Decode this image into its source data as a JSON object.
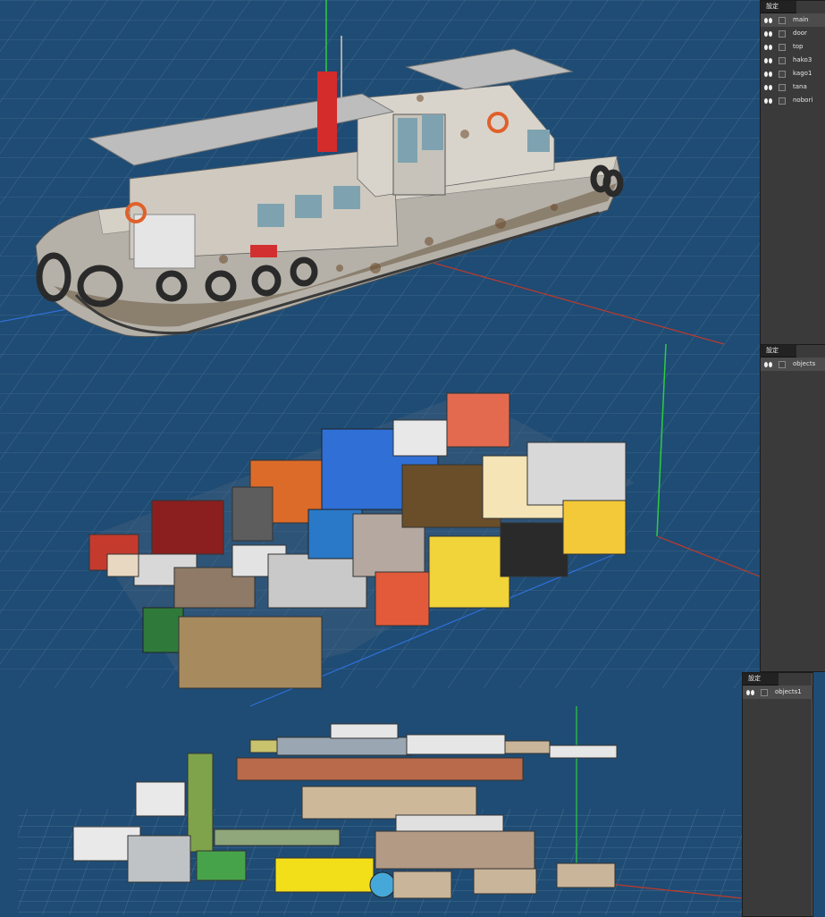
{
  "panels": [
    {
      "title": "設定",
      "layers": [
        {
          "name": "main",
          "selected": true
        },
        {
          "name": "door",
          "selected": false
        },
        {
          "name": "top",
          "selected": false
        },
        {
          "name": "hako3",
          "selected": false
        },
        {
          "name": "kago1",
          "selected": false
        },
        {
          "name": "tana",
          "selected": false
        },
        {
          "name": "nobori",
          "selected": false
        }
      ]
    },
    {
      "title": "設定",
      "layers": [
        {
          "name": "objects",
          "selected": true
        }
      ]
    },
    {
      "title": "設定",
      "layers": [
        {
          "name": "objects1",
          "selected": true
        }
      ]
    }
  ],
  "colors": {
    "background": "#1f4c74",
    "grid": "#4d7394",
    "axis_x": "#c0392b",
    "axis_y": "#2ecc40",
    "panel": "#3a3a3a",
    "hull": "#b5b1a8",
    "rust": "#8b5a2b"
  },
  "icons": [
    "visibility-eye-icon",
    "layer-checkbox"
  ]
}
